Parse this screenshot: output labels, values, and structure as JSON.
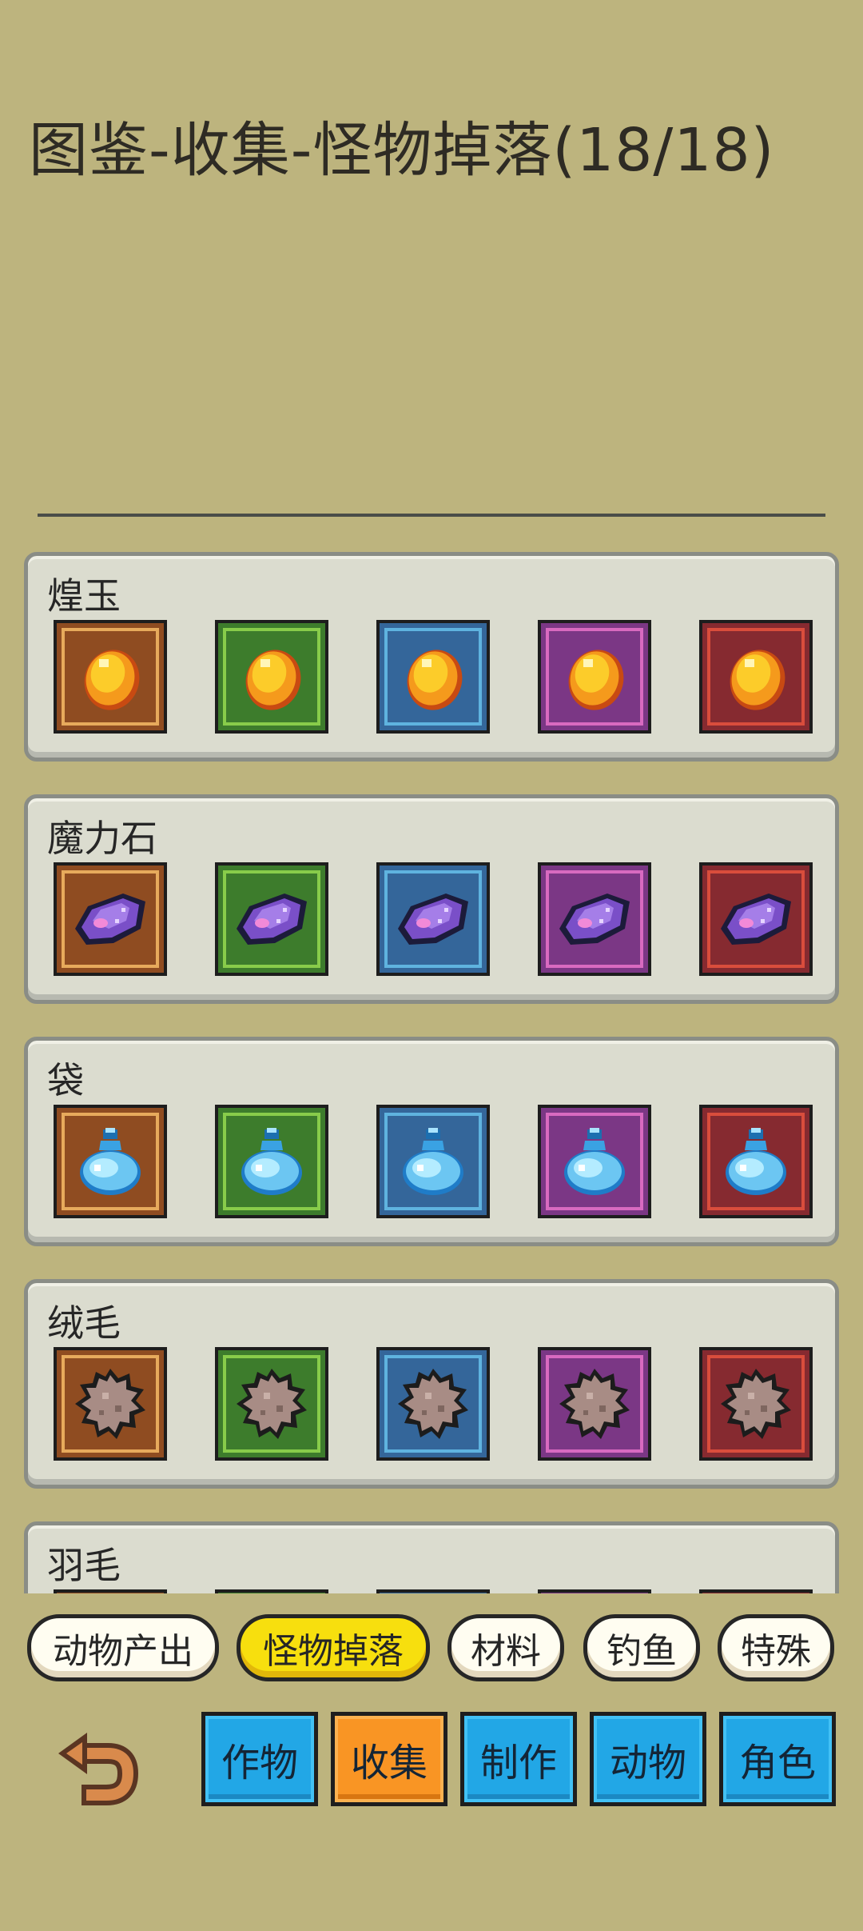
{
  "title": "图鉴-收集-怪物掉落(18/18)",
  "slot_palettes": [
    {
      "bg": "#8f4c21",
      "border": "#e7aa5c"
    },
    {
      "bg": "#3d7c2c",
      "border": "#88cc4a"
    },
    {
      "bg": "#34669a",
      "border": "#5fb3df"
    },
    {
      "bg": "#7b3785",
      "border": "#d86ac0"
    },
    {
      "bg": "#862a30",
      "border": "#d94d3c"
    }
  ],
  "categories": [
    {
      "label": "煌玉",
      "icon": "gold-gem-icon",
      "count": 5
    },
    {
      "label": "魔力石",
      "icon": "purple-crystal-icon",
      "count": 5
    },
    {
      "label": "袋",
      "icon": "blue-potion-icon",
      "count": 5
    },
    {
      "label": "绒毛",
      "icon": "fur-tuft-icon",
      "count": 5
    },
    {
      "label": "羽毛",
      "icon": "feather-icon",
      "count": 5
    }
  ],
  "sub_tabs": [
    {
      "label": "动物产出",
      "active": false
    },
    {
      "label": "怪物掉落",
      "active": true
    },
    {
      "label": "材料",
      "active": false
    },
    {
      "label": "钓鱼",
      "active": false
    },
    {
      "label": "特殊",
      "active": false
    }
  ],
  "main_tabs": [
    {
      "label": "作物",
      "active": false
    },
    {
      "label": "收集",
      "active": true
    },
    {
      "label": "制作",
      "active": false
    },
    {
      "label": "动物",
      "active": false
    },
    {
      "label": "角色",
      "active": false
    }
  ],
  "back_icon": "undo-arrow-icon"
}
